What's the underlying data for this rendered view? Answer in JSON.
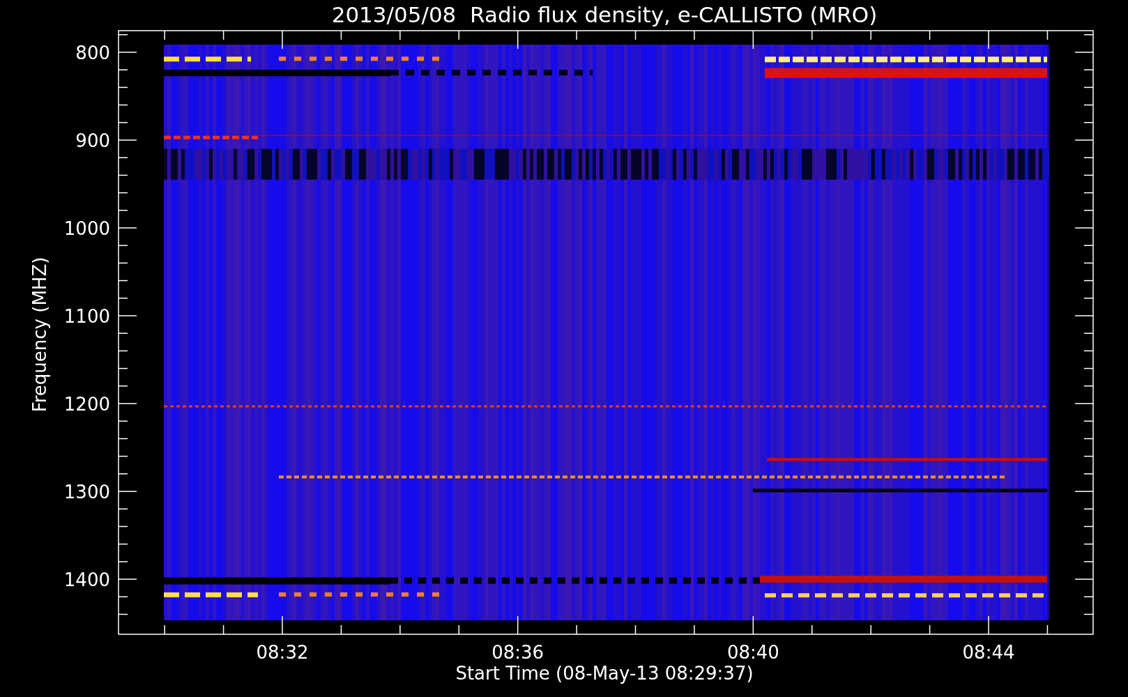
{
  "title": "2013/05/08  Radio flux density, e-CALLISTO (MRO)",
  "y_axis": {
    "label": "Frequency (MHZ)",
    "ticks": [
      "800",
      "900",
      "1000",
      "1100",
      "1200",
      "1300",
      "1400"
    ]
  },
  "x_axis": {
    "label": "Start Time (08-May-13 08:29:37)",
    "ticks": [
      "08:32",
      "08:36",
      "08:40",
      "08:44"
    ]
  }
}
